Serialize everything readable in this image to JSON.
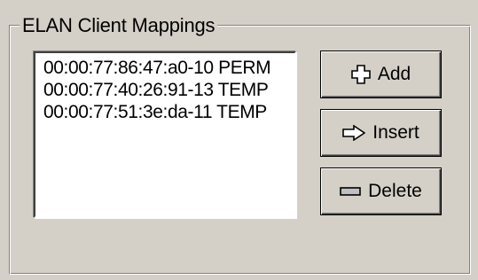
{
  "group": {
    "title": "ELAN Client Mappings"
  },
  "mappings": [
    {
      "text": "00:00:77:86:47:a0-10  PERM"
    },
    {
      "text": "00:00:77:40:26:91-13  TEMP"
    },
    {
      "text": "00:00:77:51:3e:da-11  TEMP"
    }
  ],
  "buttons": {
    "add": {
      "label": "Add",
      "icon": "plus-icon"
    },
    "insert": {
      "label": "Insert",
      "icon": "arrow-right-icon"
    },
    "delete": {
      "label": "Delete",
      "icon": "minus-icon"
    }
  }
}
